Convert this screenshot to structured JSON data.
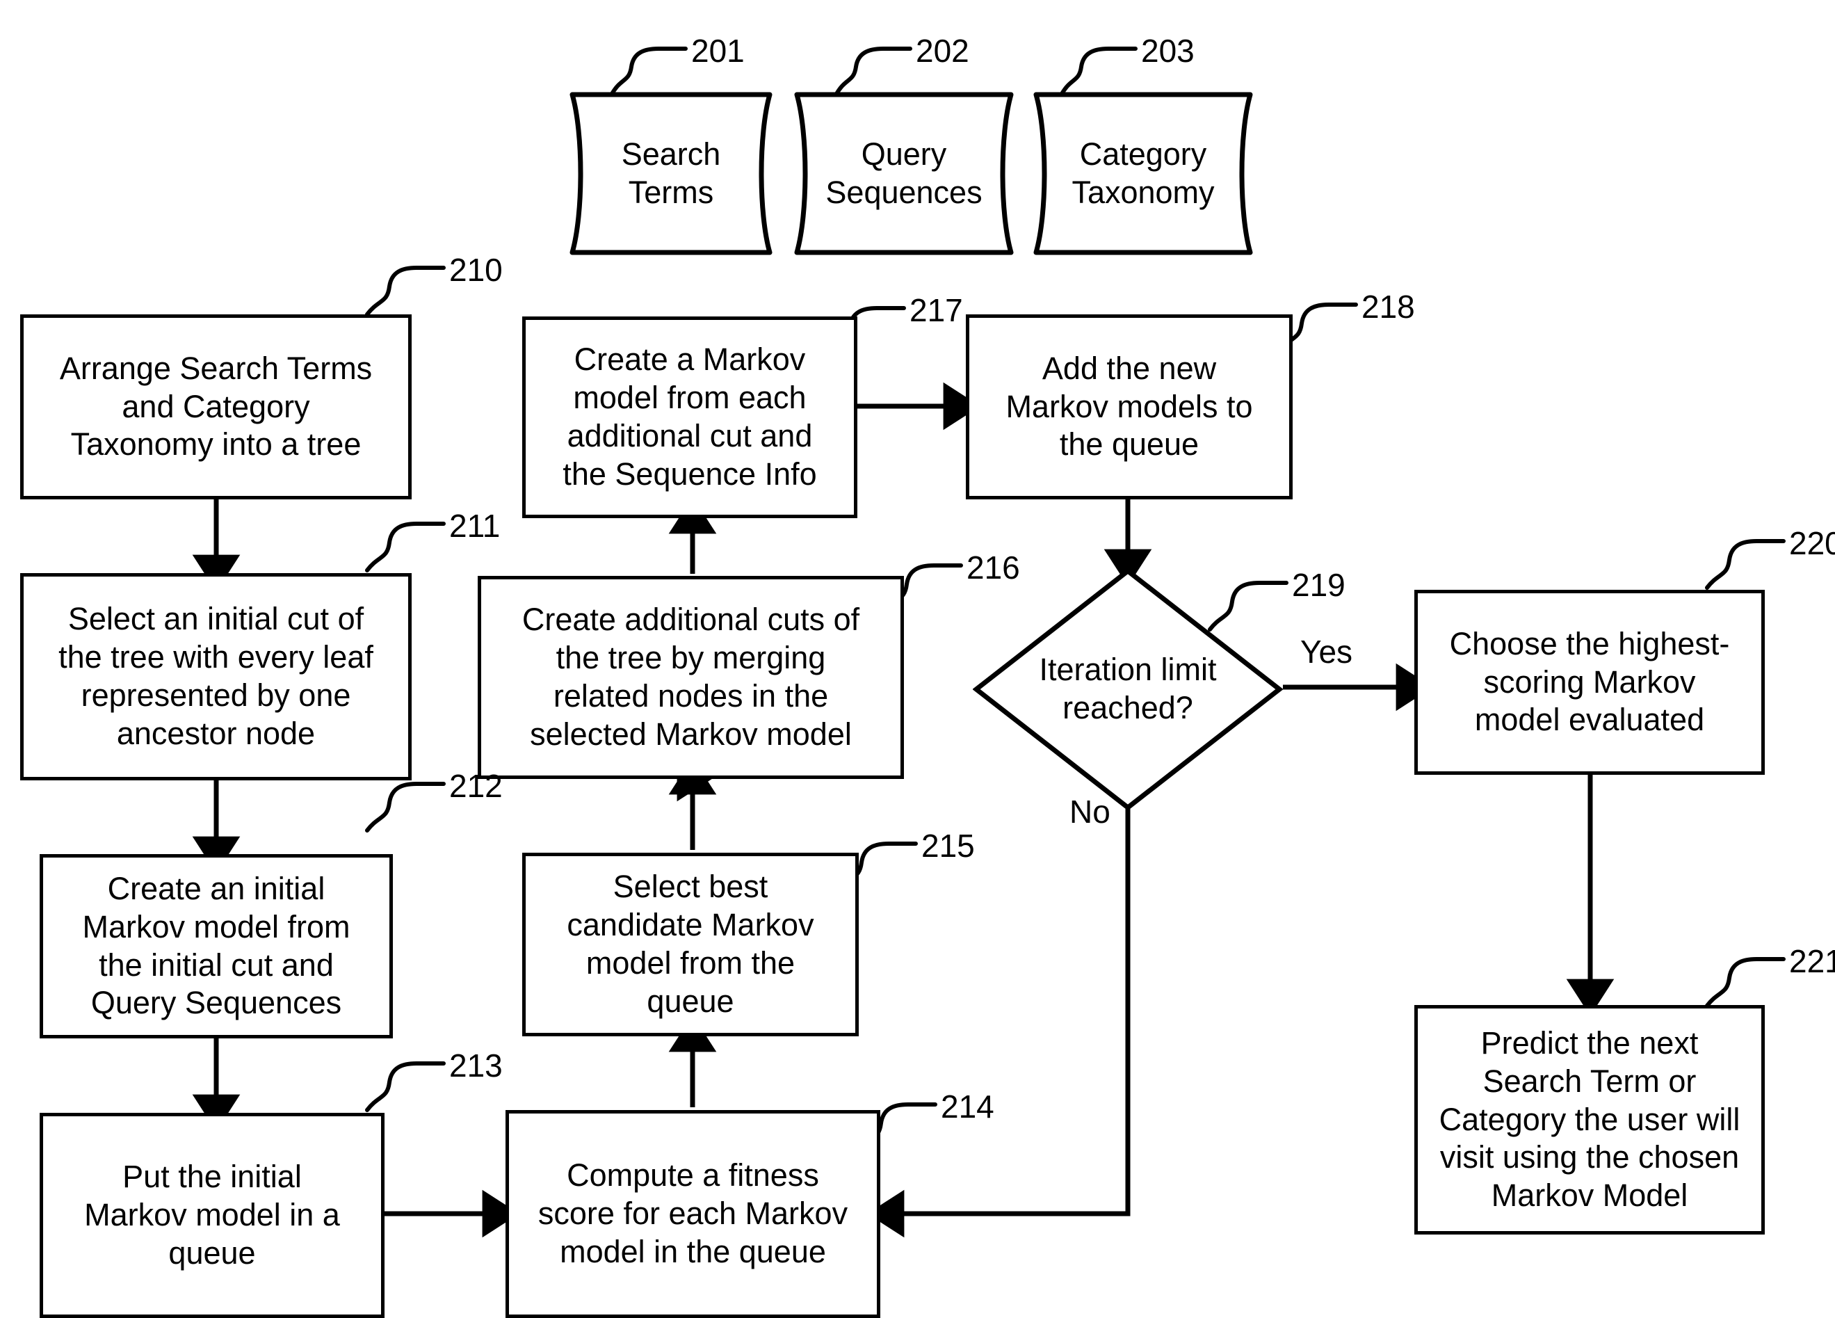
{
  "figure": {
    "type": "flowchart",
    "background_color": "#ffffff",
    "line_color": "#000000"
  },
  "data_stores": [
    {
      "ref": "201",
      "label": "Search\nTerms"
    },
    {
      "ref": "202",
      "label": "Query\nSequences"
    },
    {
      "ref": "203",
      "label": "Category\nTaxonomy"
    }
  ],
  "process_nodes": [
    {
      "ref": "210",
      "label": "Arrange Search Terms\nand Category\nTaxonomy into a tree"
    },
    {
      "ref": "211",
      "label": "Select an initial cut of\nthe tree with every leaf\nrepresented by one\nancestor node"
    },
    {
      "ref": "212",
      "label": "Create an initial\nMarkov model from\nthe initial cut and\nQuery Sequences"
    },
    {
      "ref": "213",
      "label": "Put the initial\nMarkov model in a\nqueue"
    },
    {
      "ref": "214",
      "label": "Compute a fitness\nscore for each Markov\nmodel in the queue"
    },
    {
      "ref": "215",
      "label": "Select best\ncandidate Markov\nmodel from the\nqueue"
    },
    {
      "ref": "216",
      "label": "Create additional cuts of\nthe tree by merging\nrelated nodes in the\nselected Markov model"
    },
    {
      "ref": "217",
      "label": "Create a Markov\nmodel from each\nadditional cut and\nthe Sequence Info"
    },
    {
      "ref": "218",
      "label": "Add the new\nMarkov models to\nthe queue"
    },
    {
      "ref": "220",
      "label": "Choose the highest-\nscoring Markov\nmodel evaluated"
    },
    {
      "ref": "221",
      "label": "Predict the next\nSearch Term or\nCategory the user will\nvisit using the chosen\nMarkov Model"
    }
  ],
  "decision_nodes": [
    {
      "ref": "219",
      "label": "Iteration limit\nreached?"
    }
  ],
  "edge_labels": {
    "yes": "Yes",
    "no": "No"
  },
  "connections": [
    {
      "from": "210",
      "to": "211",
      "label": ""
    },
    {
      "from": "211",
      "to": "212",
      "label": ""
    },
    {
      "from": "212",
      "to": "213",
      "label": ""
    },
    {
      "from": "213",
      "to": "214",
      "label": ""
    },
    {
      "from": "214",
      "to": "215",
      "label": ""
    },
    {
      "from": "215",
      "to": "216",
      "label": ""
    },
    {
      "from": "216",
      "to": "217",
      "label": ""
    },
    {
      "from": "217",
      "to": "218",
      "label": ""
    },
    {
      "from": "218",
      "to": "219",
      "label": ""
    },
    {
      "from": "219",
      "to": "220",
      "label": "Yes"
    },
    {
      "from": "219",
      "to": "214",
      "label": "No"
    },
    {
      "from": "220",
      "to": "221",
      "label": ""
    }
  ]
}
